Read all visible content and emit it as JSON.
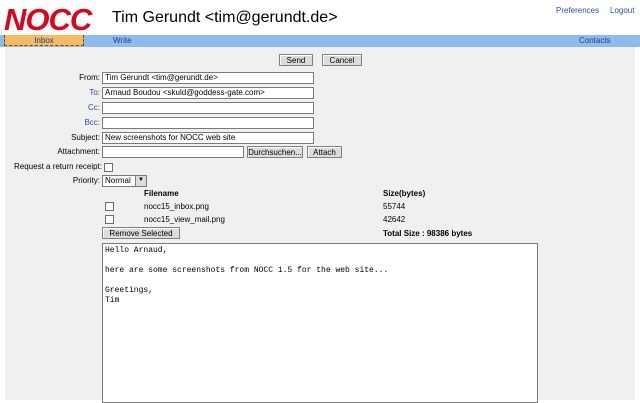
{
  "header": {
    "logo": "NOCC",
    "user": "Tim Gerundt <tim@gerundt.de>",
    "preferences": "Preferences",
    "logout": "Logout"
  },
  "nav": {
    "inbox": "Inbox",
    "write": "Write",
    "contacts": "Contacts"
  },
  "toolbar": {
    "send": "Send",
    "cancel": "Cancel"
  },
  "form": {
    "from_label": "From:",
    "from_value": "Tim Gerundt <tim@gerundt.de>",
    "to_label": "To:",
    "to_value": "Arnaud Boudou <skuld@goddess-gate.com>",
    "cc_label": "Cc:",
    "cc_value": "",
    "bcc_label": "Bcc:",
    "bcc_value": "",
    "subject_label": "Subject:",
    "subject_value": "New screenshots for NOCC web site",
    "attachment_label": "Attachment:",
    "attachment_value": "",
    "browse": "Durchsuchen...",
    "attach": "Attach",
    "receipt_label": "Request a return receipt:",
    "priority_label": "Priority:",
    "priority_value": "Normal"
  },
  "attachments": {
    "col_filename": "Filename",
    "col_size": "Size(bytes)",
    "rows": [
      {
        "filename": "nocc15_inbox.png",
        "size": "55744"
      },
      {
        "filename": "nocc15_view_mail.png",
        "size": "42642"
      }
    ],
    "remove": "Remove Selected",
    "total": "Total Size : 98386 bytes"
  },
  "message": {
    "body": "Hello Arnaud,\n\nhere are some screenshots from NOCC 1.5 for the web site...\n\nGreetings,\nTim"
  }
}
